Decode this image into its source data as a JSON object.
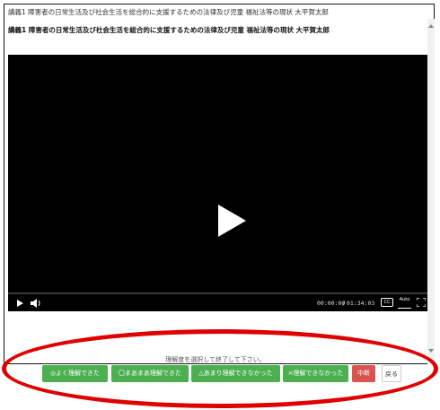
{
  "window": {
    "title": "講義1 障害者の日常生活及び社会生活を総合的に支援するための法律及び児童 福祉法等の現状 大平賀太郎"
  },
  "lecture": {
    "heading": "講義1 障害者の日常生活及び社会生活を総合的に支援するための法律及び児童 福祉法等の現状 大平賀太郎"
  },
  "player": {
    "current_time": "00:00:00",
    "separator": "/",
    "total_time": "01:34:03",
    "progress": 0,
    "cc_label": "CC",
    "audio_desc_label": "Auto",
    "icons": [
      "play-icon",
      "volume-icon",
      "closed-caption-icon",
      "audio-description-icon",
      "fullscreen-icon"
    ]
  },
  "rating": {
    "instruction": "理解度を選択して終了して下さい。",
    "buttons": [
      {
        "label": "◎よく理解できた",
        "color": "#4caf50"
      },
      {
        "label": "〇まあまあ理解できた",
        "color": "#4caf50"
      },
      {
        "label": "△あまり理解できなかった",
        "color": "#4caf50"
      },
      {
        "label": "×理解できなかった",
        "color": "#4caf50"
      },
      {
        "label": "中断",
        "color": "#d9534f"
      },
      {
        "label": "戻る",
        "color": "#ffffff"
      }
    ]
  },
  "annotation": {
    "color": "#e00000"
  }
}
